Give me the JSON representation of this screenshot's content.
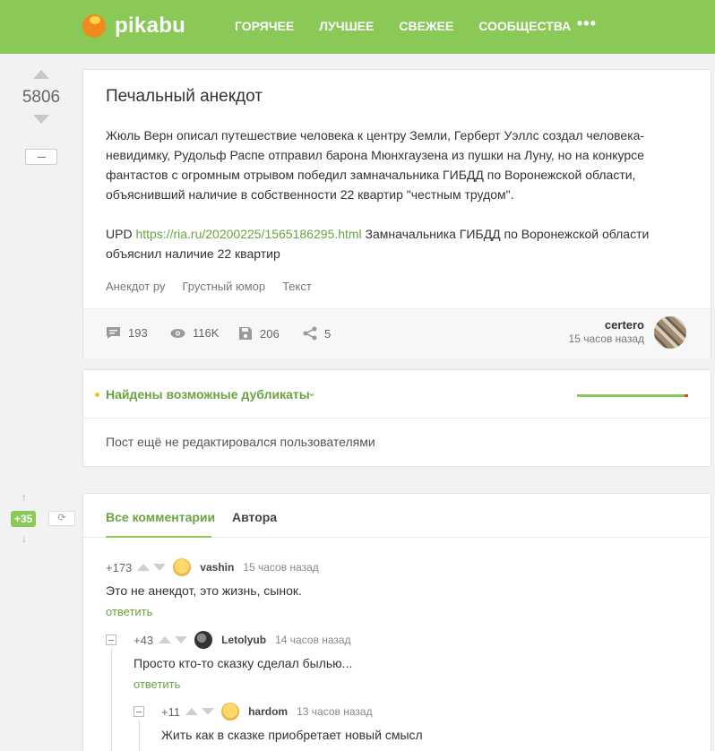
{
  "header": {
    "logo_text": "pikabu",
    "nav": [
      "ГОРЯЧЕЕ",
      "ЛУЧШЕЕ",
      "СВЕЖЕЕ",
      "СООБЩЕСТВА"
    ],
    "more": "•••"
  },
  "post": {
    "rating": "5806",
    "title": "Печальный анекдот",
    "body": "Жюль Верн описал путешествие человека к центру Земли, Герберт Уэллс создал человека-невидимку, Рудольф Распе отправил барона Мюнхгаузена из пушки на Луну, но на конкурсе фантастов с огромным отрывом победил замначальника ГИБДД по Воронежской области, объяснивший наличие в собственности 22 квартир \"честным трудом\".",
    "upd_prefix": "UPD",
    "upd_link": "https://ria.ru/20200225/1565186295.html",
    "upd_suffix": "Замначальника ГИБДД по Воронежской области объяснил наличие 22 квартир",
    "tags": [
      "Анекдот ру",
      "Грустный юмор",
      "Текст"
    ],
    "stats": {
      "comments": "193",
      "views": "116K",
      "saves": "206",
      "shares": "5"
    },
    "author": "certero",
    "time": "15 часов назад"
  },
  "duplicates": {
    "title": "Найдены возможные дубликаты",
    "chevron": "⌄",
    "text": "Пост ещё не редактировался пользователями"
  },
  "comments_meta": {
    "new_badge": "+35",
    "refresh": "⟳",
    "up": "↑",
    "down": "↓"
  },
  "comment_tabs": [
    "Все комментарии",
    "Автора"
  ],
  "comments": [
    {
      "score": "+173",
      "user": "vashin",
      "time": "15 часов назад",
      "text": "Это не анекдот, это жизнь, сынок.",
      "reply": "ответить"
    },
    {
      "score": "+43",
      "user": "Letolyub",
      "time": "14 часов назад",
      "text": "Просто кто-то сказку сделал былью...",
      "reply": "ответить"
    },
    {
      "score": "+11",
      "user": "hardom",
      "time": "13 часов назад",
      "text": "Жить как в сказке приобретает новый смысл"
    }
  ],
  "colors": {
    "brand_green": "#8ac858",
    "link_green": "#6aa341",
    "logo_orange": "#f08a1c"
  }
}
